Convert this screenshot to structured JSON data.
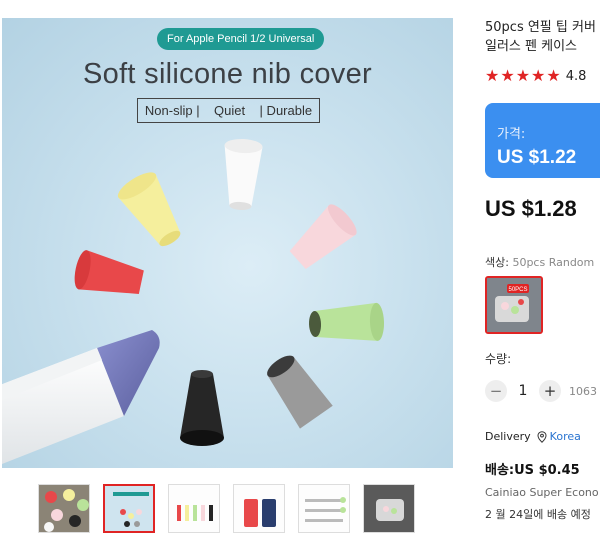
{
  "hero": {
    "badge": "For Apple Pencil 1/2 Universal",
    "title": "Soft silicone nib cover",
    "features": "Non-slip |    Quiet    | Durable",
    "nib_colors": [
      "#f5ef9d",
      "#f7f7f7",
      "#f8d7dc",
      "#b9e39a",
      "#9a9a9a",
      "#262626",
      "#e8484a"
    ]
  },
  "thumbnails": [
    {
      "name": "thumb-1"
    },
    {
      "name": "thumb-2",
      "active": true
    },
    {
      "name": "thumb-3"
    },
    {
      "name": "thumb-4"
    },
    {
      "name": "thumb-5"
    },
    {
      "name": "thumb-6"
    }
  ],
  "product": {
    "title_line1": "50pcs 연필 팁 커버",
    "title_line2": "일러스 펜 케이스",
    "rating": "4.8",
    "price_label": "가격:",
    "price_card": "US $1.22",
    "price": "US $1.28",
    "color_label": "색상:",
    "color_value": "50pcs Random",
    "swatch_caption": "50PCS",
    "qty_label": "수량:",
    "qty_value": "1",
    "stock": "1063",
    "delivery_label": "Delivery",
    "delivery_location": "Korea",
    "shipping_fee": "배송:US $0.45",
    "carrier": "Cainiao Super Econo",
    "eta": "2 월 24일에 배송 예정"
  },
  "colors": {
    "accent_red": "#e02424",
    "price_blue": "#3b8ff0",
    "badge_teal": "#1f9a93",
    "link_blue": "#2a74d0"
  },
  "icons": [
    "star-icon",
    "minus-icon",
    "plus-icon",
    "location-pin-icon"
  ]
}
